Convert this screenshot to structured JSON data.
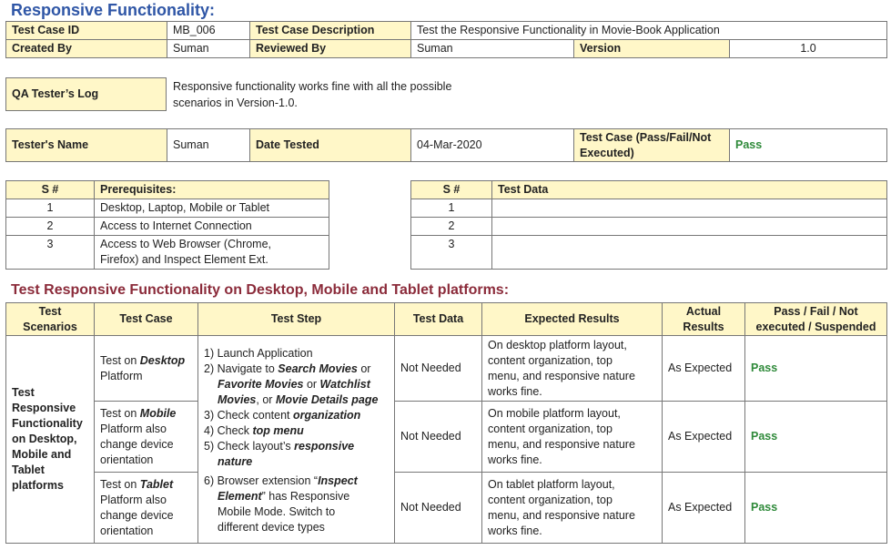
{
  "title": "Responsive Functionality:",
  "header": {
    "test_case_id_label": "Test Case ID",
    "test_case_id": "MB_006",
    "description_label": "Test Case Description",
    "description": "Test the Responsive Functionality in Movie-Book Application",
    "created_by_label": "Created By",
    "created_by": "Suman",
    "reviewed_by_label": "Reviewed By",
    "reviewed_by": "Suman",
    "version_label": "Version",
    "version": "1.0"
  },
  "qa_log": {
    "label": "QA Tester’s Log",
    "line1": "Responsive functionality works fine with all the possible",
    "line2": "scenarios in Version-1.0."
  },
  "tester": {
    "name_label": "Tester's Name",
    "name": "Suman",
    "date_label": "Date Tested",
    "date": "04-Mar-2020",
    "result_label_1": "Test Case (Pass/Fail/Not",
    "result_label_2": "Executed)",
    "result": "Pass"
  },
  "prerequisites": {
    "col_sn": "S #",
    "col_name": "Prerequisites:",
    "rows": [
      {
        "sn": "1",
        "line1": "Desktop, Laptop, Mobile or Tablet",
        "line2": ""
      },
      {
        "sn": "2",
        "line1": "Access to Internet Connection",
        "line2": ""
      },
      {
        "sn": "3",
        "line1": "Access to Web Browser (Chrome,",
        "line2": "Firefox) and Inspect Element Ext."
      }
    ]
  },
  "test_data": {
    "col_sn": "S #",
    "col_name": "Test Data",
    "rows": [
      {
        "sn": "1",
        "value": ""
      },
      {
        "sn": "2",
        "value": ""
      },
      {
        "sn": "3",
        "value": ""
      }
    ]
  },
  "section_title": "Test Responsive Functionality on Desktop, Mobile and Tablet platforms:",
  "main_table": {
    "headers": {
      "scenarios_1": "Test",
      "scenarios_2": "Scenarios",
      "test_case": "Test Case",
      "test_step": "Test Step",
      "test_data": "Test Data",
      "expected": "Expected Results",
      "actual_1": "Actual",
      "actual_2": "Results",
      "status_1": "Pass / Fail / Not",
      "status_2": "executed / Suspended"
    },
    "scenario": [
      "Test",
      "Responsive",
      "Functionality",
      "on Desktop,",
      "Mobile and",
      "Tablet",
      "platforms"
    ],
    "steps": {
      "s1": "1) Launch Application",
      "s2a": "2) Navigate to ",
      "s2b": "Search Movies",
      "s2c": " or",
      "s2d": "Favorite Movies",
      "s2e": " or ",
      "s2f": "Watchlist",
      "s2g": "Movies",
      "s2h": ", or ",
      "s2i": "Movie Details page",
      "s3a": "3) Check content ",
      "s3b": "organization",
      "s4a": "4) Check ",
      "s4b": "top menu",
      "s5a": "5) Check layout’s ",
      "s5b": "responsive",
      "s5c": "nature",
      "s6a": "6) Browser extension “",
      "s6b": "Inspect",
      "s6c": "Element",
      "s6d": "” has Responsive",
      "s6e": "Mobile Mode. Switch to",
      "s6f": "different device types"
    },
    "rows": [
      {
        "case_a": "Test on ",
        "case_b": "Desktop",
        "case_c": "Platform",
        "case_d": "",
        "case_e": "",
        "data": "Not Needed",
        "exp": [
          "On desktop platform layout,",
          "content organization, top",
          "menu, and responsive nature",
          "works fine."
        ],
        "actual": "As Expected",
        "status": "Pass"
      },
      {
        "case_a": "Test on ",
        "case_b": "Mobile",
        "case_c": "Platform also",
        "case_d": "change device",
        "case_e": "orientation",
        "data": "Not Needed",
        "exp": [
          "On mobile platform layout,",
          "content organization, top",
          "menu, and responsive nature",
          "works fine."
        ],
        "actual": "As Expected",
        "status": "Pass"
      },
      {
        "case_a": "Test on ",
        "case_b": "Tablet",
        "case_c": "Platform also",
        "case_d": "change device",
        "case_e": "orientation",
        "data": "Not Needed",
        "exp": [
          "On tablet platform layout,",
          "content organization, top",
          "menu, and responsive nature",
          "works fine."
        ],
        "actual": "As Expected",
        "status": "Pass"
      }
    ]
  },
  "colors": {
    "title": "#2f56a6",
    "section_title": "#8b2b3a",
    "highlight": "#fff7c8",
    "pass": "#2f8a3a"
  }
}
